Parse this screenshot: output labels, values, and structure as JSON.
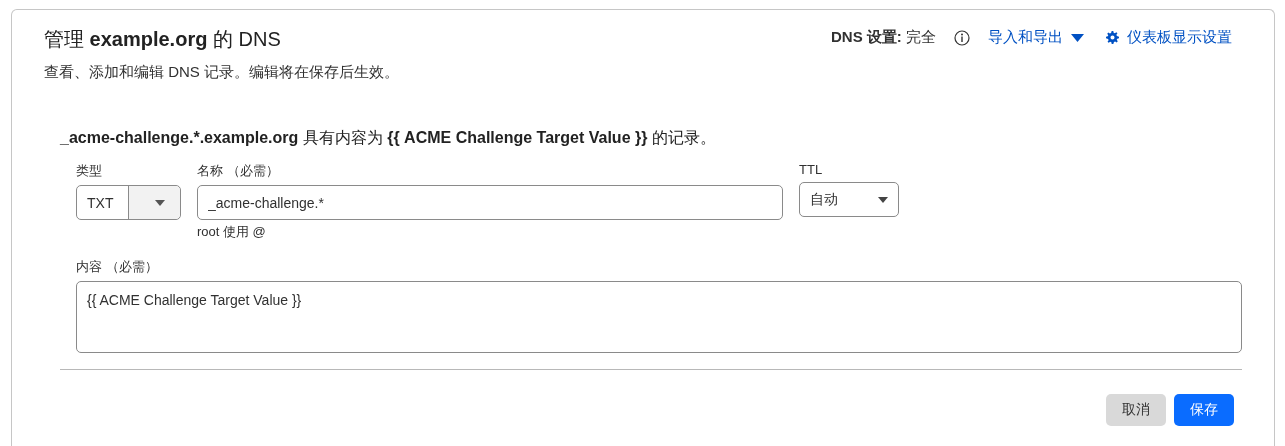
{
  "header": {
    "title": "管理 **example.org** 的 DNS",
    "subtitle": "查看、添加和编辑 DNS 记录。编辑将在保存后生效。",
    "dns_setting_label": "DNS 设置:",
    "dns_setting_value": "完全",
    "links": [
      {
        "label": "导入和导出",
        "kind": "dropdown"
      },
      {
        "label": "仪表板显示设置",
        "kind": "settings"
      }
    ]
  },
  "record": {
    "summary": [
      {
        "text": "_acme-challenge.*.example.org",
        "bold": true
      },
      {
        "text": " 具有内容为 ",
        "bold": false
      },
      {
        "text": "{{ ACME Challenge Target Value }}",
        "bold": true
      },
      {
        "text": " 的记录。",
        "bold": false
      }
    ],
    "type": {
      "label": "类型",
      "value": "TXT"
    },
    "name": {
      "label": "名称 （必需）",
      "value": "_acme-challenge.*",
      "hint": "root 使用 @"
    },
    "ttl": {
      "label": "TTL",
      "value": "自动"
    },
    "content": {
      "label": "内容 （必需）",
      "value": "{{ ACME Challenge Target Value }}"
    }
  },
  "buttons": [
    {
      "label": "取消",
      "kind": "secondary"
    },
    {
      "label": "保存",
      "kind": "primary"
    }
  ]
}
